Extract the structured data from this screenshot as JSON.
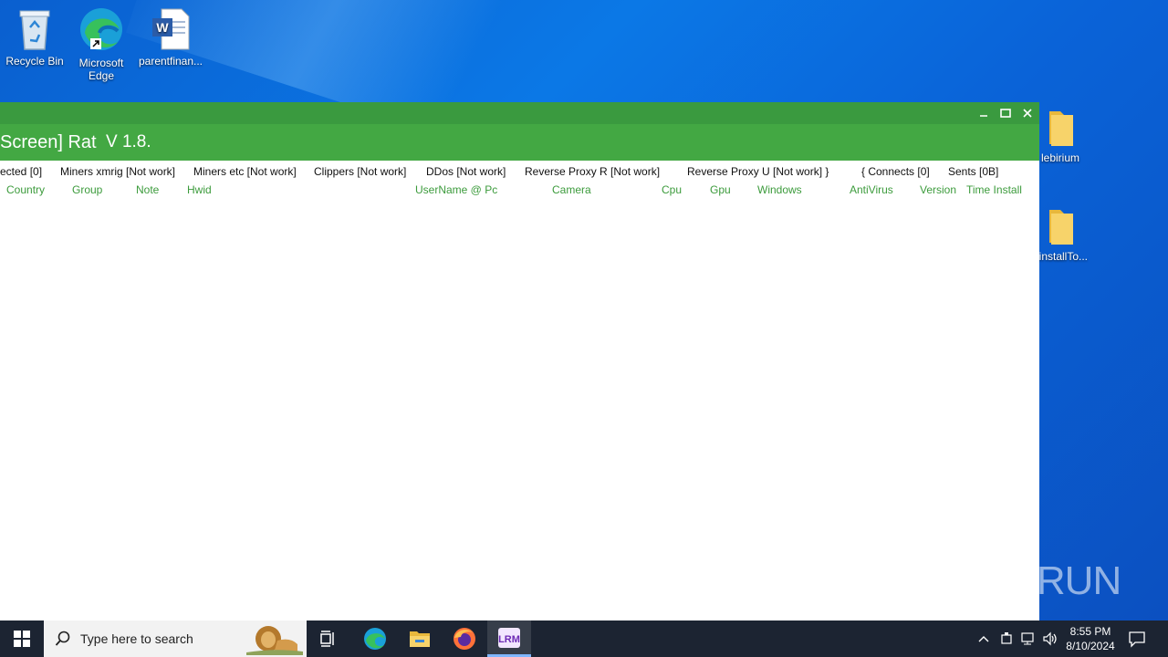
{
  "desktop": {
    "icons": [
      {
        "label": "Recycle Bin"
      },
      {
        "label": "Microsoft Edge"
      },
      {
        "label": "parentfinan..."
      },
      {
        "label": "lebirium"
      },
      {
        "label": "ninstallTo..."
      }
    ]
  },
  "window": {
    "title": "Screen] Rat",
    "version": "V 1.8.",
    "tabs": [
      "ected [0]",
      "Miners xmrig [Not work]",
      "Miners etc [Not work]",
      "Clippers [Not work]",
      "DDos [Not work]",
      "Reverse Proxy R [Not work]",
      "Reverse Proxy U [Not work] }",
      "{ Connects [0]",
      "Sents [0B]"
    ],
    "columns": [
      "Country",
      "Group",
      "Note",
      "Hwid",
      "UserName @ Pc",
      "Camera",
      "Cpu",
      "Gpu",
      "Windows",
      "AntiVirus",
      "Version",
      "Time Install"
    ]
  },
  "taskbar": {
    "search_placeholder": "Type here to search",
    "time": "8:55 PM",
    "date": "8/10/2024"
  },
  "watermark": "ANY RUN",
  "colors": {
    "titlebar": "#3a9a3f",
    "header": "#43a843",
    "column_text": "#3c9b3c"
  }
}
